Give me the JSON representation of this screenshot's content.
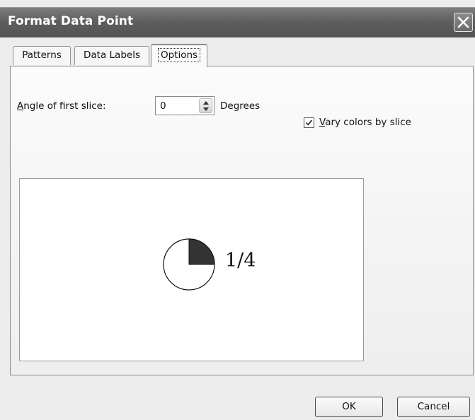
{
  "window": {
    "title": "Format Data Point",
    "close_icon": "close-icon"
  },
  "tabs": [
    {
      "label": "Patterns",
      "active": false
    },
    {
      "label": "Data Labels",
      "active": false
    },
    {
      "label": "Options",
      "active": true
    }
  ],
  "options": {
    "angle_label_prefix": "A",
    "angle_label_rest": "ngle of first slice:",
    "angle_value": "0",
    "angle_unit": "Degrees",
    "vary_colors_prefix": "V",
    "vary_colors_rest": "ary colors by slice",
    "vary_colors_checked": true
  },
  "preview": {
    "label": "1/4",
    "slice_fraction": 0.25,
    "slice_color": "#333333"
  },
  "buttons": {
    "ok_label": "OK",
    "cancel_label": "Cancel"
  },
  "colors": {
    "titlebar": "#5e5e5e",
    "dialog_bg": "#ececec",
    "panel_bg": "#f7f7f7"
  }
}
